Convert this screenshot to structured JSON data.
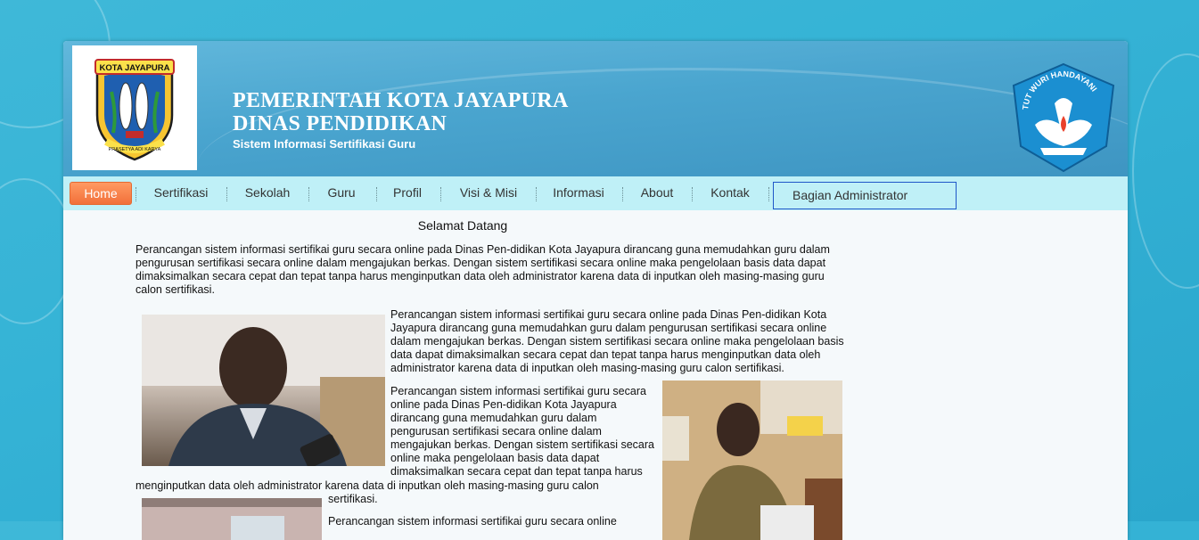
{
  "header": {
    "title_line1": "PEMERINTAH KOTA JAYAPURA",
    "title_line2": "DINAS PENDIDIKAN",
    "subtitle": "Sistem Informasi Sertifikasi Guru",
    "left_logo_text_top": "KOTA JAYAPURA",
    "left_logo_text_bottom": "PRASETYA ADI KARYA",
    "right_logo_text": "TUT WURI HANDAYANI"
  },
  "nav": {
    "items": [
      "Home",
      "Sertifikasi",
      "Sekolah",
      "Guru",
      "Profil",
      "Visi & Misi",
      "Informasi",
      "About",
      "Kontak"
    ],
    "admin": "Bagian Administrator"
  },
  "content": {
    "welcome": "Selamat Datang",
    "intro": "Perancangan sistem informasi sertifikai guru secara online pada Dinas Pen-didikan Kota Jayapura dirancang guna memudahkan guru dalam pengurusan sertifikasi secara online dalam mengajukan berkas. Dengan sistem sertifikasi secara online maka pengelolaan basis data dapat dimaksimalkan secara cepat dan tepat tanpa harus menginputkan data oleh administrator karena data di inputkan oleh masing-masing guru calon sertifikasi.",
    "para2": "Perancangan sistem informasi sertifikai guru secara online pada Dinas Pen-didikan Kota Jayapura dirancang guna memudahkan guru dalam pengurusan sertifikasi secara online dalam mengajukan berkas. Dengan sistem sertifikasi secara online maka pengelolaan basis data dapat dimaksimalkan secara cepat dan tepat tanpa harus menginputkan data oleh administrator karena data di inputkan oleh masing-masing guru calon sertifikasi.",
    "para3_part1": "Perancangan sistem informasi sertifikai guru secara online pada Dinas Pen-didikan Kota Jayapura dirancang guna memudahkan guru dalam pengurusan sertifikasi secara online dalam mengajukan berkas. Dengan sistem sertifikasi secara online maka pengelolaan basis data dapat dimaksimalkan secara cepat dan tepat tanpa harus",
    "para3_part2": "menginputkan data oleh administrator karena data di inputkan oleh masing-masing guru calon",
    "para3_part3": "sertifikasi.",
    "para4": "Perancangan sistem informasi sertifikai guru secara online"
  },
  "colors": {
    "background": "#35b3d6",
    "header": "#4aa5cf",
    "nav": "#bff0f7",
    "home_button": "#f2703a",
    "admin_border": "#1e56c8"
  }
}
